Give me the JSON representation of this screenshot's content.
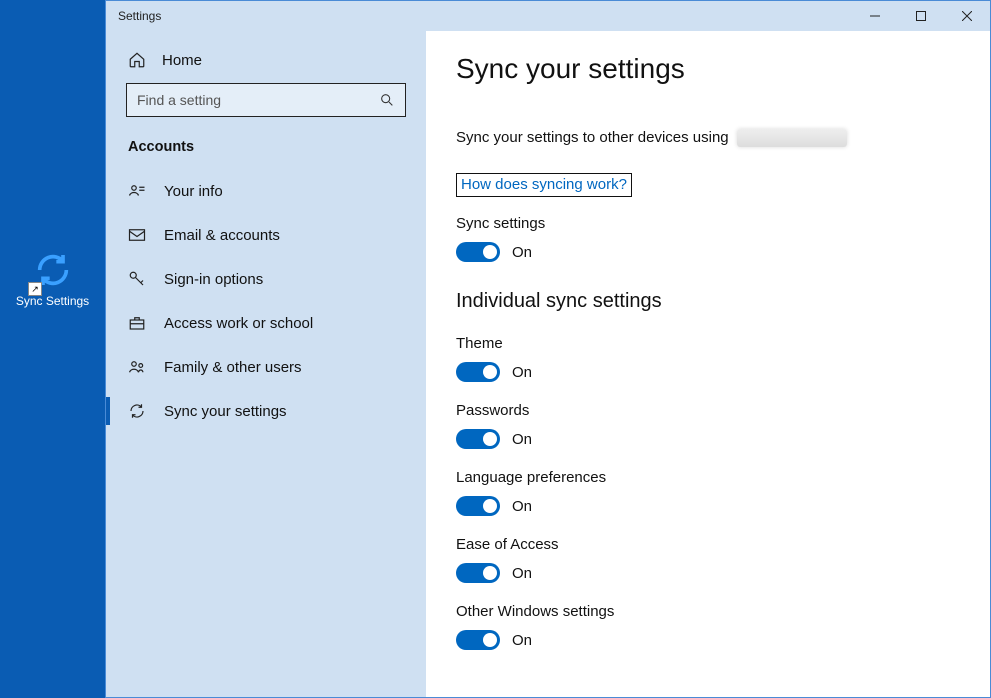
{
  "window": {
    "title": "Settings"
  },
  "desktop_icon": {
    "label": "Sync Settings"
  },
  "sidebar": {
    "home": "Home",
    "search_placeholder": "Find a setting",
    "category": "Accounts",
    "items": [
      {
        "label": "Your info"
      },
      {
        "label": "Email & accounts"
      },
      {
        "label": "Sign-in options"
      },
      {
        "label": "Access work or school"
      },
      {
        "label": "Family & other users"
      },
      {
        "label": "Sync your settings"
      }
    ]
  },
  "page": {
    "title": "Sync your settings",
    "description": "Sync your settings to other devices using",
    "help_link": "How does syncing work?",
    "sync": {
      "label": "Sync settings",
      "state": "On"
    },
    "section": "Individual sync settings",
    "items": [
      {
        "label": "Theme",
        "state": "On"
      },
      {
        "label": "Passwords",
        "state": "On"
      },
      {
        "label": "Language preferences",
        "state": "On"
      },
      {
        "label": "Ease of Access",
        "state": "On"
      },
      {
        "label": "Other Windows settings",
        "state": "On"
      }
    ]
  }
}
